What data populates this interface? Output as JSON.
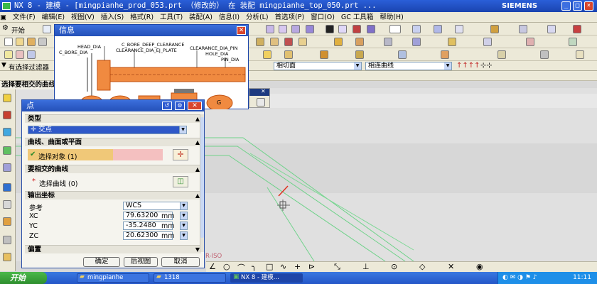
{
  "window": {
    "title": "NX 8 - 建模 - [mingpianhe_prod_053.prt （修改的）  在 装配 mingpianhe_top_050.prt   ...",
    "brand": "SIEMENS",
    "minimize": "_",
    "maximize": "□",
    "close": "×"
  },
  "menu": [
    "文件(F)",
    "编辑(E)",
    "视图(V)",
    "插入(S)",
    "格式(R)",
    "工具(T)",
    "装配(A)",
    "信息(I)",
    "分析(L)",
    "首选项(P)",
    "窗口(O)",
    "GC 工具箱",
    "帮助(H)"
  ],
  "toolbar": {
    "start_label": "开始"
  },
  "filterbar": {
    "filter_label": "有选择过滤器",
    "combo1": "相切面",
    "combo2": "相连曲线"
  },
  "cue": "选择要相交的曲线",
  "info_window": {
    "title": "信息",
    "labels": {
      "head_dia": "HEAD_DIA",
      "c_bore_dia": "C_BORE_DIA",
      "c_bore_deep_clearance": "C_BORE_DEEP_CLEARANCE",
      "clearance_dia_ej_plate": "CLEARANCE_DIA_EJ_PLATE",
      "clearance_dia_pin": "CLEARANCE_DIA_PIN",
      "hole_dia": "HOLE_DIA",
      "pin_dia": "PIN_DIA",
      "g_mark": "G"
    }
  },
  "dialog": {
    "title": "点",
    "sections": {
      "type": "类型",
      "curves": "曲线、曲面或平面",
      "intersect": "要相交的曲线",
      "output": "输出坐标",
      "offset": "偏置"
    },
    "type_value": "交点",
    "select_object": "选择对象 (1)",
    "select_curve": "选择曲线 (0)",
    "reference_label": "参考",
    "reference_value": "WCS",
    "coords": [
      {
        "axis": "XC",
        "value": "79.63200",
        "unit": "mm"
      },
      {
        "axis": "YC",
        "value": "-35.2480",
        "unit": "mm"
      },
      {
        "axis": "ZC",
        "value": "20.62300",
        "unit": "mm"
      }
    ],
    "buttons": {
      "ok": "确定",
      "back": "后视图",
      "cancel": "取消"
    }
  },
  "viewport": {
    "view_label": "R-ISO"
  },
  "taskbar": {
    "start": "开始",
    "tasks": [
      "mingpianhe",
      "1318",
      "NX 8 - 建模..."
    ],
    "time": "11:11"
  },
  "colors": {
    "titlebar": "#1a44b0",
    "geometry": "#6fd28a",
    "highlight": "#e03020"
  }
}
